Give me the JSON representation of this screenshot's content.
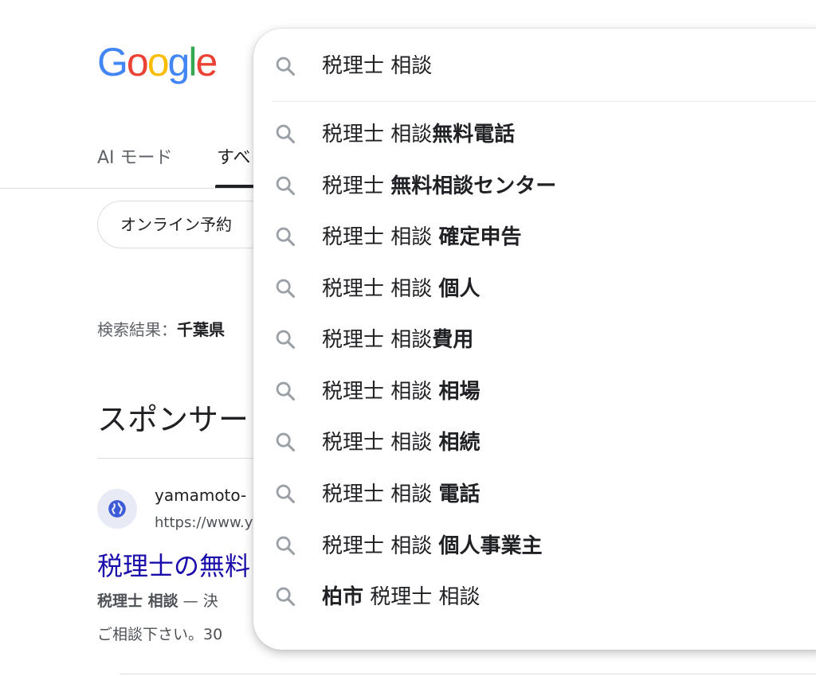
{
  "logo": {
    "letters": [
      {
        "ch": "G",
        "color": "#4285F4"
      },
      {
        "ch": "o",
        "color": "#EA4335"
      },
      {
        "ch": "o",
        "color": "#FBBC05"
      },
      {
        "ch": "g",
        "color": "#4285F4"
      },
      {
        "ch": "l",
        "color": "#34A853"
      },
      {
        "ch": "e",
        "color": "#EA4335"
      }
    ]
  },
  "tabs": {
    "ai_mode": "AI モード",
    "all": "すべ"
  },
  "chip": {
    "label": "オンライン予約"
  },
  "results_for": {
    "prefix": "検索結果：",
    "location": "千葉県"
  },
  "sponsor": {
    "heading": "スポンサー"
  },
  "ad": {
    "site": "yamamoto-",
    "url": "https://www.y",
    "title": "税理士の無料",
    "snippet_bold": "税理士 相談",
    "snippet_rest": " — 決",
    "snippet2": "ご相談下さい。30"
  },
  "search": {
    "query": "税理士 相談"
  },
  "suggestions": [
    {
      "plain": "税理士 相談",
      "bold": "無料電話",
      "bold_first": false
    },
    {
      "plain": "税理士 ",
      "bold": "無料相談センター",
      "bold_first": false
    },
    {
      "plain": "税理士 相談 ",
      "bold": "確定申告",
      "bold_first": false
    },
    {
      "plain": "税理士 相談 ",
      "bold": "個人",
      "bold_first": false
    },
    {
      "plain": "税理士 相談",
      "bold": "費用",
      "bold_first": false
    },
    {
      "plain": "税理士 相談 ",
      "bold": "相場",
      "bold_first": false
    },
    {
      "plain": "税理士 相談 ",
      "bold": "相続",
      "bold_first": false
    },
    {
      "plain": "税理士 相談 ",
      "bold": "電話",
      "bold_first": false
    },
    {
      "plain": "税理士 相談 ",
      "bold": "個人事業主",
      "bold_first": false
    },
    {
      "plain": " 税理士 相談",
      "bold": "柏市",
      "bold_first": true
    }
  ]
}
